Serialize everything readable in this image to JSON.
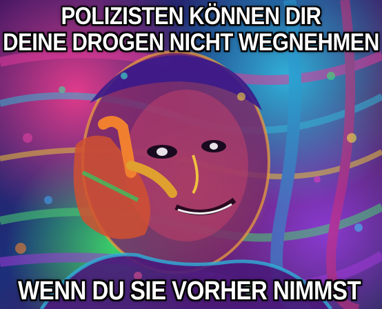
{
  "meme": {
    "top_text": [
      "POLIZISTEN KÖNNEN DIR",
      "DEINE DROGEN NICHT WEGNEHMEN"
    ],
    "bottom_text": "WENN DU SIE VORHER NIMMST"
  },
  "colors": {
    "caption_text": "#ffffff",
    "caption_outline": "#000000",
    "palette": [
      "#e13b8a",
      "#2fb0d8",
      "#f0a23a",
      "#3ad06a",
      "#8a3ad0"
    ]
  }
}
